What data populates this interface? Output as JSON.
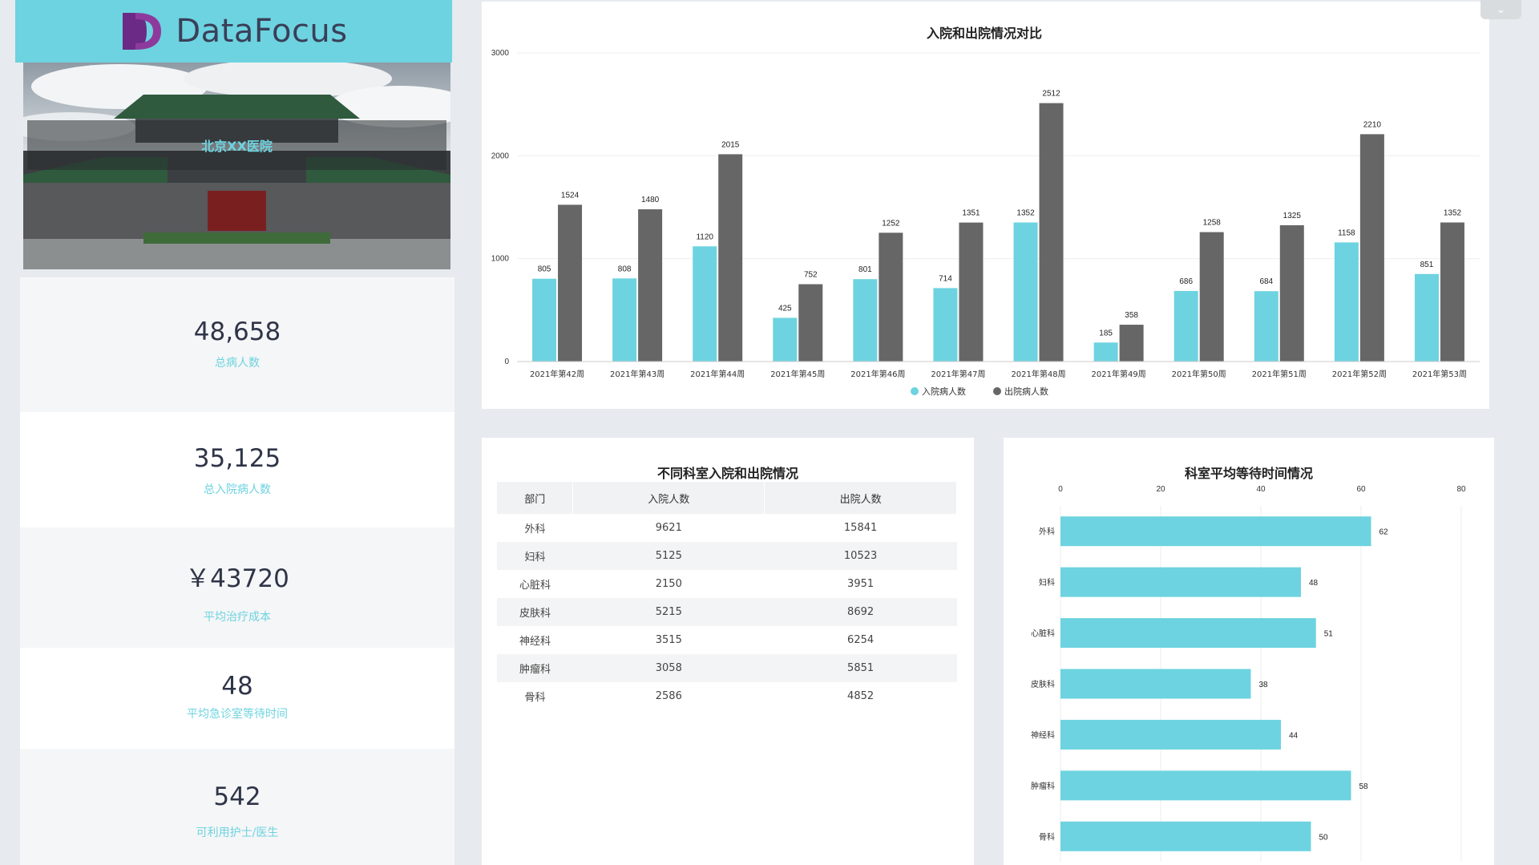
{
  "brand": {
    "name": "DataFocus",
    "logo_colors": [
      "#6a2a86",
      "#8e3a9d"
    ]
  },
  "hospital": {
    "name": "北京XX医院"
  },
  "kpis": [
    {
      "value": "48,658",
      "label": "总病人数"
    },
    {
      "value": "35,125",
      "label": "总入院病人数"
    },
    {
      "value": "￥43720",
      "label": "平均治疗成本"
    },
    {
      "value": "48",
      "label": "平均急诊室等待时间"
    },
    {
      "value": "542",
      "label": "可利用护士/医生"
    }
  ],
  "colors": {
    "accent": "#6dd3e0",
    "dark": "#666666",
    "text_dark": "#2f3548"
  },
  "corner_button": {
    "icon": "chevron-down-icon"
  },
  "bar_chart": {
    "title": "入院和出院情况对比",
    "chart_data": {
      "type": "bar",
      "categories": [
        "2021年第42周",
        "2021年第43周",
        "2021年第44周",
        "2021年第45周",
        "2021年第46周",
        "2021年第47周",
        "2021年第48周",
        "2021年第49周",
        "2021年第50周",
        "2021年第51周",
        "2021年第52周",
        "2021年第53周"
      ],
      "series": [
        {
          "name": "入院病人数",
          "color": "#6dd3e0",
          "values": [
            805,
            808,
            1120,
            425,
            801,
            714,
            1352,
            185,
            686,
            684,
            1158,
            851
          ]
        },
        {
          "name": "出院病人数",
          "color": "#666666",
          "values": [
            1524,
            1480,
            2015,
            752,
            1252,
            1351,
            2512,
            358,
            1258,
            1325,
            2210,
            1352
          ]
        }
      ],
      "ylim": [
        0,
        3000
      ],
      "yticks": [
        0,
        1000,
        2000,
        3000
      ],
      "legend": "bottom"
    }
  },
  "dept_table": {
    "title": "不同科室入院和出院情况",
    "headers": [
      "部门",
      "入院人数",
      "出院人数"
    ],
    "rows": [
      [
        "外科",
        "9621",
        "15841"
      ],
      [
        "妇科",
        "5125",
        "10523"
      ],
      [
        "心脏科",
        "2150",
        "3951"
      ],
      [
        "皮肤科",
        "5215",
        "8692"
      ],
      [
        "神经科",
        "3515",
        "6254"
      ],
      [
        "肿瘤科",
        "3058",
        "5851"
      ],
      [
        "骨科",
        "2586",
        "4852"
      ]
    ]
  },
  "wait_chart": {
    "title": "科室平均等待时间情况",
    "chart_data": {
      "type": "bar",
      "orientation": "horizontal",
      "categories": [
        "外科",
        "妇科",
        "心脏科",
        "皮肤科",
        "神经科",
        "肿瘤科",
        "骨科"
      ],
      "values": [
        62,
        48,
        51,
        38,
        44,
        58,
        50
      ],
      "xlim": [
        0,
        80
      ],
      "xticks": [
        0,
        20,
        40,
        60,
        80
      ],
      "color": "#6dd3e0"
    }
  }
}
